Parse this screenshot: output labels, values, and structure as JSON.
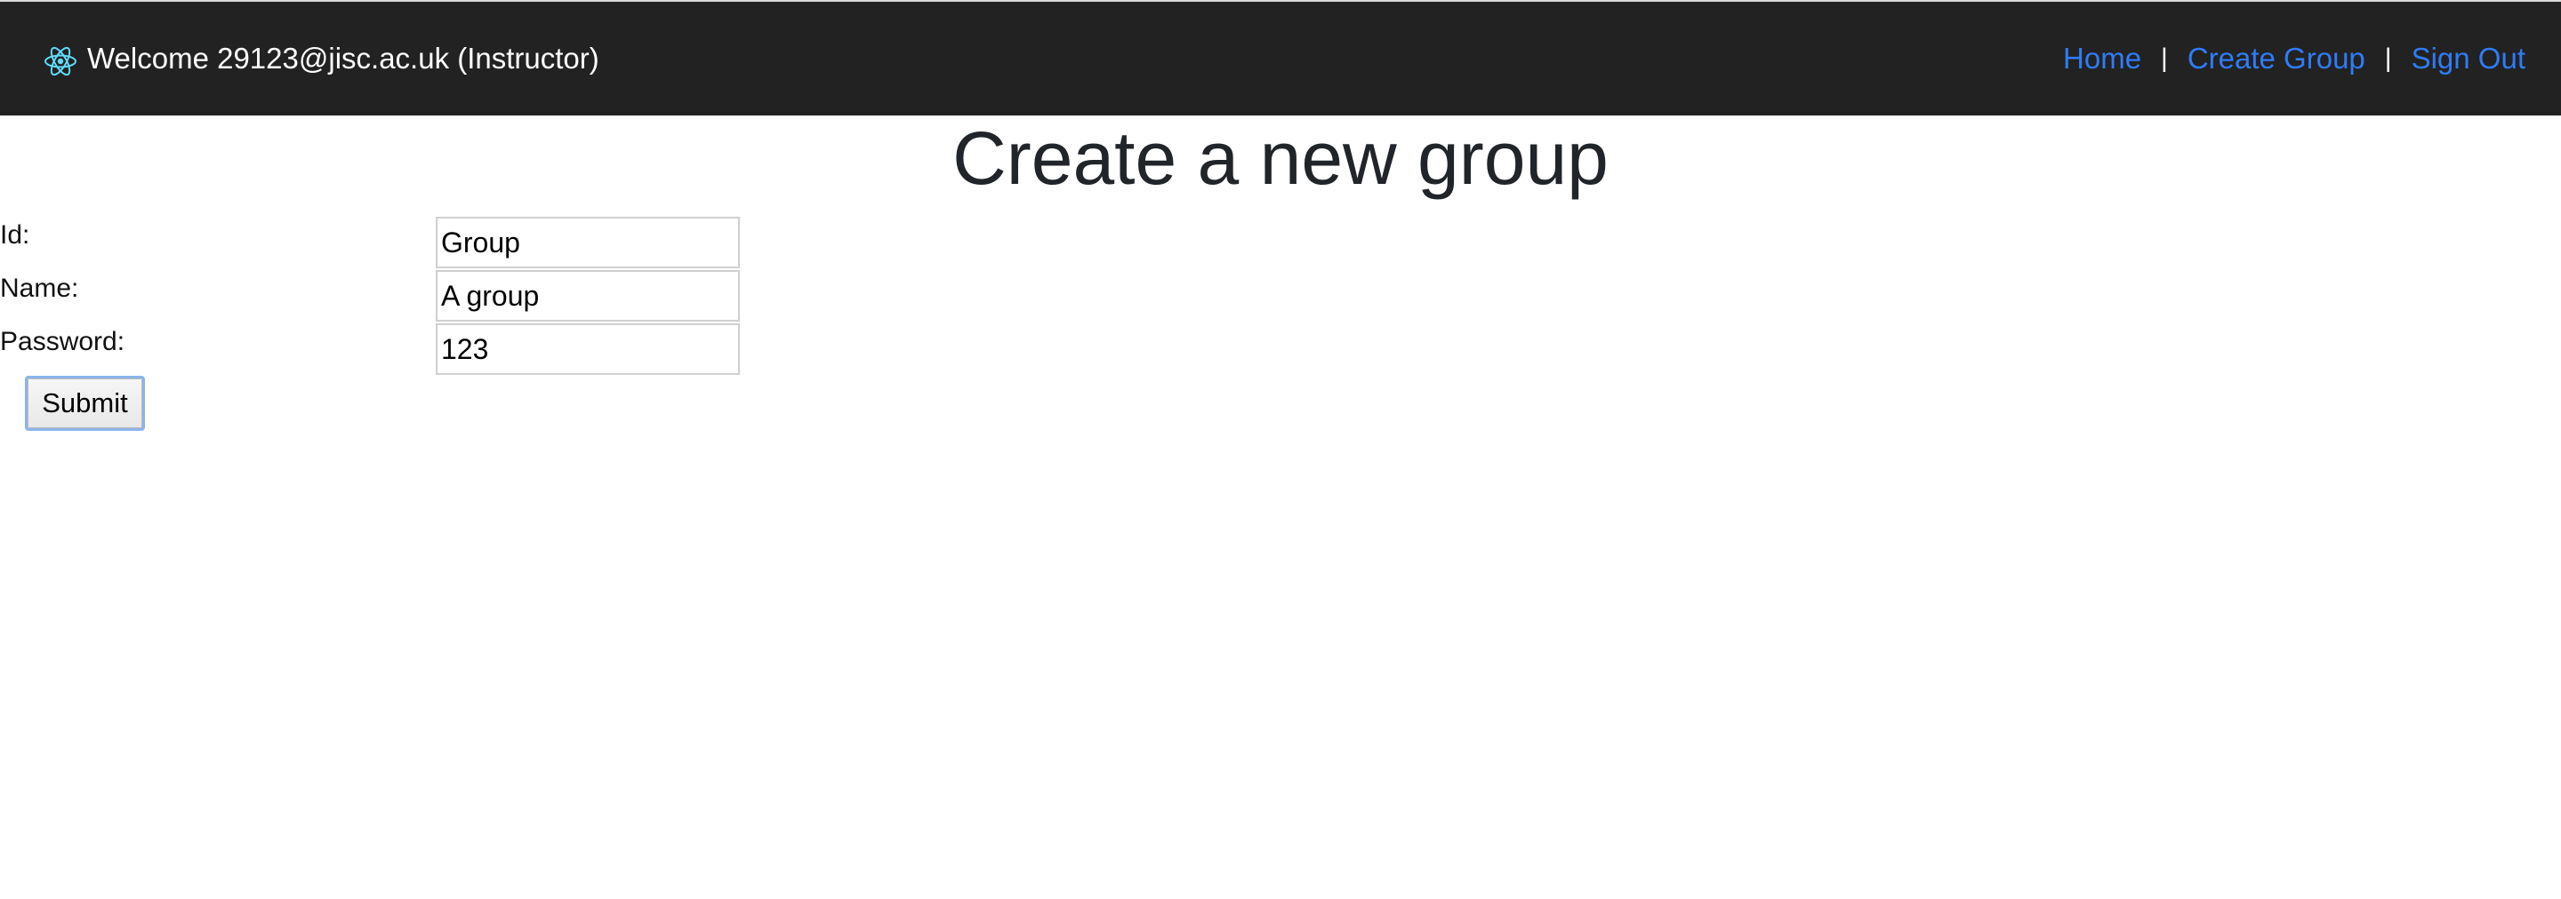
{
  "navbar": {
    "brand_icon": "react-atom-icon",
    "welcome_text": "Welcome 29123@jisc.ac.uk (Instructor)",
    "links": [
      {
        "label": "Home"
      },
      {
        "label": "Create Group"
      },
      {
        "label": "Sign Out"
      }
    ],
    "separator": "|",
    "link_color": "#2f7cf6",
    "background_color": "#222222"
  },
  "page": {
    "title": "Create a new group"
  },
  "form": {
    "id_label": "Id:",
    "id_value": "Group",
    "name_label": "Name:",
    "name_value": "A group",
    "password_label": "Password:",
    "password_value": "123",
    "submit_label": "Submit"
  }
}
